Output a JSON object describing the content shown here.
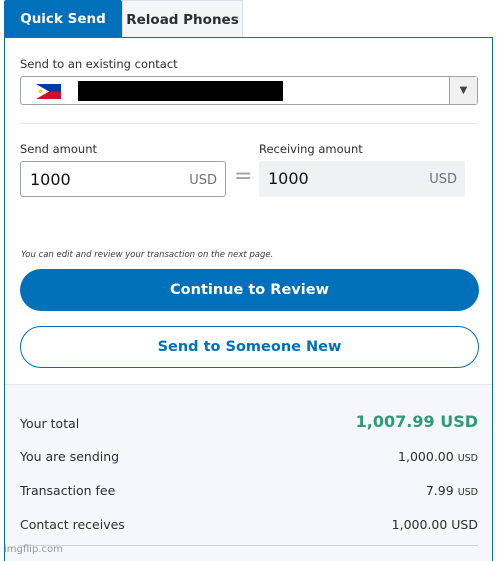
{
  "tabs": [
    {
      "label": "Quick Send",
      "active": true
    },
    {
      "label": "Reload Phones",
      "active": false
    }
  ],
  "contact": {
    "label": "Send to an existing contact",
    "flag_icon": "philippines-flag-icon",
    "dropdown_icon": "▼"
  },
  "send_amount": {
    "label": "Send amount",
    "value": "1000",
    "currency": "USD"
  },
  "equals_sign": "=",
  "receiving_amount": {
    "label": "Receiving amount",
    "value": "1000",
    "currency": "USD"
  },
  "note": "You can edit and review your transaction on the next page.",
  "buttons": {
    "continue": "Continue to Review",
    "new_recipient": "Send to Someone New"
  },
  "summary": {
    "total_label": "Your total",
    "total_value": "1,007.99 USD",
    "sending_label": "You are sending",
    "sending_value": "1,000.00",
    "sending_currency": "USD",
    "fee_label": "Transaction fee",
    "fee_value": "7.99",
    "fee_currency": "USD",
    "receives_label": "Contact receives",
    "receives_value": "1,000.00 USD"
  },
  "watermark": "imgflip.com",
  "colors": {
    "brand_blue": "#0070ba",
    "total_green": "#2e9b73",
    "summary_bg": "#f5f7fa"
  }
}
